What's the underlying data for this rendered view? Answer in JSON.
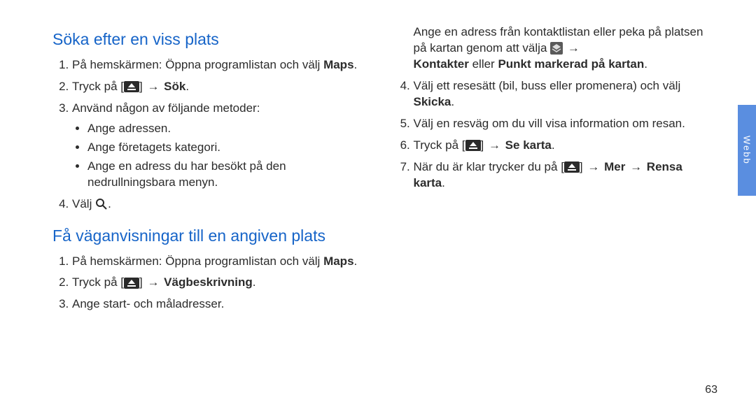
{
  "sideTab": "Webb",
  "pageNumber": "63",
  "leftCol": {
    "heading1": "Söka efter en viss plats",
    "s1": {
      "step1_a": "På hemskärmen: Öppna programlistan och välj ",
      "step1_b": "Maps",
      "step1_c": ".",
      "step2_a": "Tryck på [",
      "step2_b": "] ",
      "step2_arrow": "→",
      "step2_c": " Sök",
      "step2_d": ".",
      "step3": "Använd någon av följande metoder:",
      "bullets": {
        "b1": "Ange adressen.",
        "b2": "Ange företagets kategori.",
        "b3": "Ange en adress du har besökt på den nedrullningsbara menyn."
      },
      "step4_a": "Välj ",
      "step4_b": "."
    },
    "heading2": "Få väganvisningar till en angiven plats",
    "s2": {
      "step1_a": "På hemskärmen: Öppna programlistan och välj ",
      "step1_b": "Maps",
      "step1_c": ".",
      "step2_a": "Tryck på [",
      "step2_b": "] ",
      "step2_arrow": "→",
      "step2_c": " Vägbeskrivning",
      "step2_d": ".",
      "step3": "Ange start- och måladresser."
    }
  },
  "rightCol": {
    "intro_a": "Ange en adress från kontaktlistan eller peka på platsen på kartan genom att välja ",
    "intro_arrow": "→",
    "intro_b": " Kontakter",
    "intro_c": " eller ",
    "intro_d": "Punkt markerad på kartan",
    "intro_e": ".",
    "step4_a": "Välj ett resesätt (bil, buss eller promenera) och välj ",
    "step4_b": "Skicka",
    "step4_c": ".",
    "step5": "Välj en resväg om du vill visa information om resan.",
    "step6_a": "Tryck på [",
    "step6_b": "] ",
    "step6_arrow": "→",
    "step6_c": " Se karta",
    "step6_d": ".",
    "step7_a": "När du är klar trycker du på [",
    "step7_b": "] ",
    "step7_arrow1": "→",
    "step7_c": " Mer ",
    "step7_arrow2": "→",
    "step7_d": " Rensa karta",
    "step7_e": "."
  }
}
